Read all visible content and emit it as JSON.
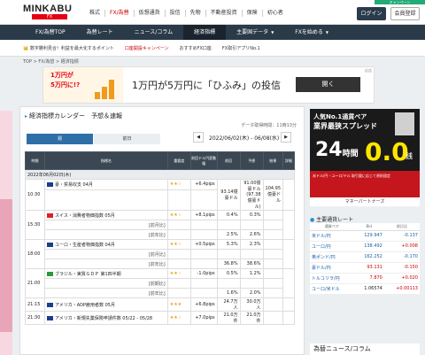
{
  "brand": {
    "logo": "MINKABU",
    "logo_sub": "FX",
    "banner": "キャンペーン"
  },
  "topnav": [
    "株式",
    "FX/為替",
    "仮想通貨",
    "投信",
    "先物",
    "不動産投資",
    "保険",
    "初心者"
  ],
  "auth": {
    "login": "ログイン",
    "register": "会員登録"
  },
  "mainnav": [
    "FX/為替TOP",
    "為替レート",
    "ニュース/コラム",
    "経済指標",
    "主要国データ",
    "FXを始める"
  ],
  "subnav": [
    "👑 数字勝利見合！利益を最大化するポイント",
    "口座開設キャンペーン",
    "おすすめFX口座",
    "FX取引アプリNo.1"
  ],
  "breadcrumb": "TOP > FX/為替 > 経済指標",
  "ad": {
    "thumb1": "1万円が",
    "thumb2": "5万円に!?",
    "text": "1万円が5万円に「ひふみ」の投信",
    "button": "開く",
    "tag": "広告"
  },
  "section": {
    "title": "経済指標カレンダー　予想＆速報",
    "updated": "データ取得時間：11時13分",
    "tab_this": "週",
    "tab_last": "前日",
    "range": "2022/06/02(木) - 06/08(水)",
    "prev": "◀",
    "next": "▶"
  },
  "table": {
    "headers": [
      "時間",
      "指標名",
      "重要度",
      "前回ドル円変動幅",
      "前回",
      "予想",
      "結果",
      "詳細"
    ],
    "date": "2022年06月02日(木)",
    "rows": [
      {
        "time": "10:30",
        "flag": "#1a3d8c",
        "name": "豪・貿易収支 04月",
        "stars": "★★☆",
        "change": "+6.4pips",
        "prev": "93.14億豪ドル",
        "forecast": "91.00億豪ドル (97.38億豪ドル)",
        "result": "104.95億豪ドル",
        "note": ""
      },
      {
        "time": "15:30",
        "flag": "#d22",
        "name": "スイス・消費者物価指数 05月",
        "stars": "★★☆",
        "change": "+8.1pips",
        "prev": "0.4%",
        "forecast": "0.3%",
        "result": "",
        "note": "[前月比]",
        "prev2": "2.5%",
        "forecast2": "2.6%"
      },
      {
        "time": "18:00",
        "flag": "#1a3d8c",
        "name": "ユーロ・生産者物価指数 04月",
        "stars": "★★☆",
        "change": "+0.5pips",
        "prev": "5.3%",
        "forecast": "2.3%",
        "result": "",
        "note": "[前月比]",
        "prev2": "36.8%",
        "forecast2": "38.6%"
      },
      {
        "time": "21:00",
        "flag": "#2a9a3a",
        "name": "ブラジル・実質ＧＤＰ 第1四半期",
        "stars": "★★☆",
        "change": "-1.0pips",
        "prev": "0.5%",
        "forecast": "1.2%",
        "result": "",
        "note": "[前期比]",
        "prev2": "1.6%",
        "forecast2": "2.0%"
      },
      {
        "time": "21:15",
        "flag": "#1a3d8c",
        "name": "アメリカ・ADP雇用者数 05月",
        "stars": "★★★",
        "change": "+6.8pips",
        "prev": "24.7万人",
        "forecast": "30.0万人",
        "result": "",
        "note": ""
      },
      {
        "time": "21:30",
        "flag": "#1a3d8c",
        "name": "アメリカ・新規失業保険申請件数 05/22 - 05/28",
        "stars": "★★☆",
        "change": "+7.0pips",
        "prev": "21.0万件",
        "forecast": "21.0万件",
        "result": "",
        "note": ""
      }
    ]
  },
  "right_ad": {
    "t1": "人気No.1通貨ペア",
    "t2": "業界最狭スプレッド",
    "big": "24",
    "big_unit": "時間",
    "zero": "0.0",
    "sen": "銭",
    "body": "米ドル/円・ユーロ/ドル 取引量に応じて原則固定",
    "footer": "マネーパートナーズ"
  },
  "rates": {
    "title": "主要通貨レート",
    "headers": [
      "通貨ペア",
      "Bid",
      "前日比"
    ],
    "rows": [
      {
        "pair": "米ドル/円",
        "bid": "129.947",
        "chg": "-0.137",
        "dir": "neg"
      },
      {
        "pair": "ユーロ/円",
        "bid": "138.492",
        "chg": "+0.008",
        "dir": "pos"
      },
      {
        "pair": "英ポンド/円",
        "bid": "162.252",
        "chg": "-0.170",
        "dir": "neg"
      },
      {
        "pair": "豪ドル/円",
        "bid": "93.131",
        "chg": "-0.150",
        "dir": "pos"
      },
      {
        "pair": "トルコリラ/円",
        "bid": "7.870",
        "chg": "+0.020",
        "dir": "pos"
      },
      {
        "pair": "ユーロ/米ドル",
        "bid": "1.06574",
        "chg": "+0.00113",
        "dir": "pos"
      }
    ]
  },
  "news_title": "為替ニュース/コラム"
}
